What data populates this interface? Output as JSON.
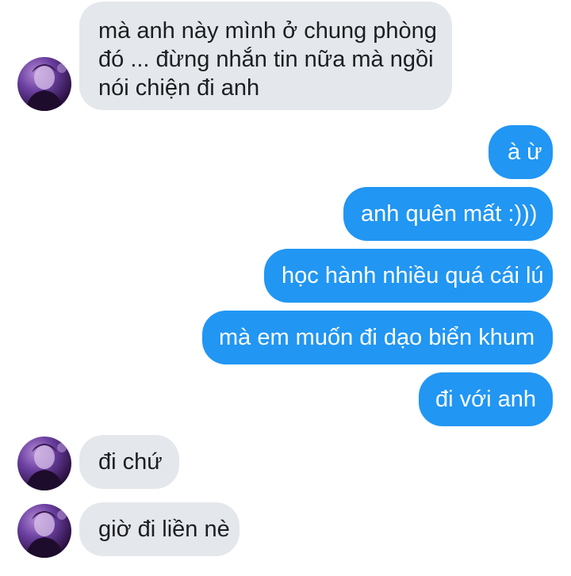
{
  "conversation": {
    "messages": [
      {
        "side": "incoming",
        "lines": [
          "mà anh này mình ở chung phòng",
          "đó ... đừng nhắn tin nữa mà ngồi",
          "nói chiện đi anh"
        ]
      },
      {
        "side": "outgoing",
        "text": "à ừ"
      },
      {
        "side": "outgoing",
        "text": "anh quên mất :)))"
      },
      {
        "side": "outgoing",
        "text": "học hành nhiều quá cái lú"
      },
      {
        "side": "outgoing",
        "text": "mà em muốn đi dạo biển khum"
      },
      {
        "side": "outgoing",
        "text": "đi với anh"
      },
      {
        "side": "incoming",
        "text": "đi chứ"
      },
      {
        "side": "incoming",
        "text": "giờ đi liền nè"
      }
    ]
  },
  "colors": {
    "incoming_bubble": "#e4e7eb",
    "outgoing_bubble": "#2196f3",
    "outgoing_text": "#ffffff",
    "incoming_text": "#1c1e21"
  },
  "icons": {
    "avatar": "contact-avatar-photo"
  }
}
